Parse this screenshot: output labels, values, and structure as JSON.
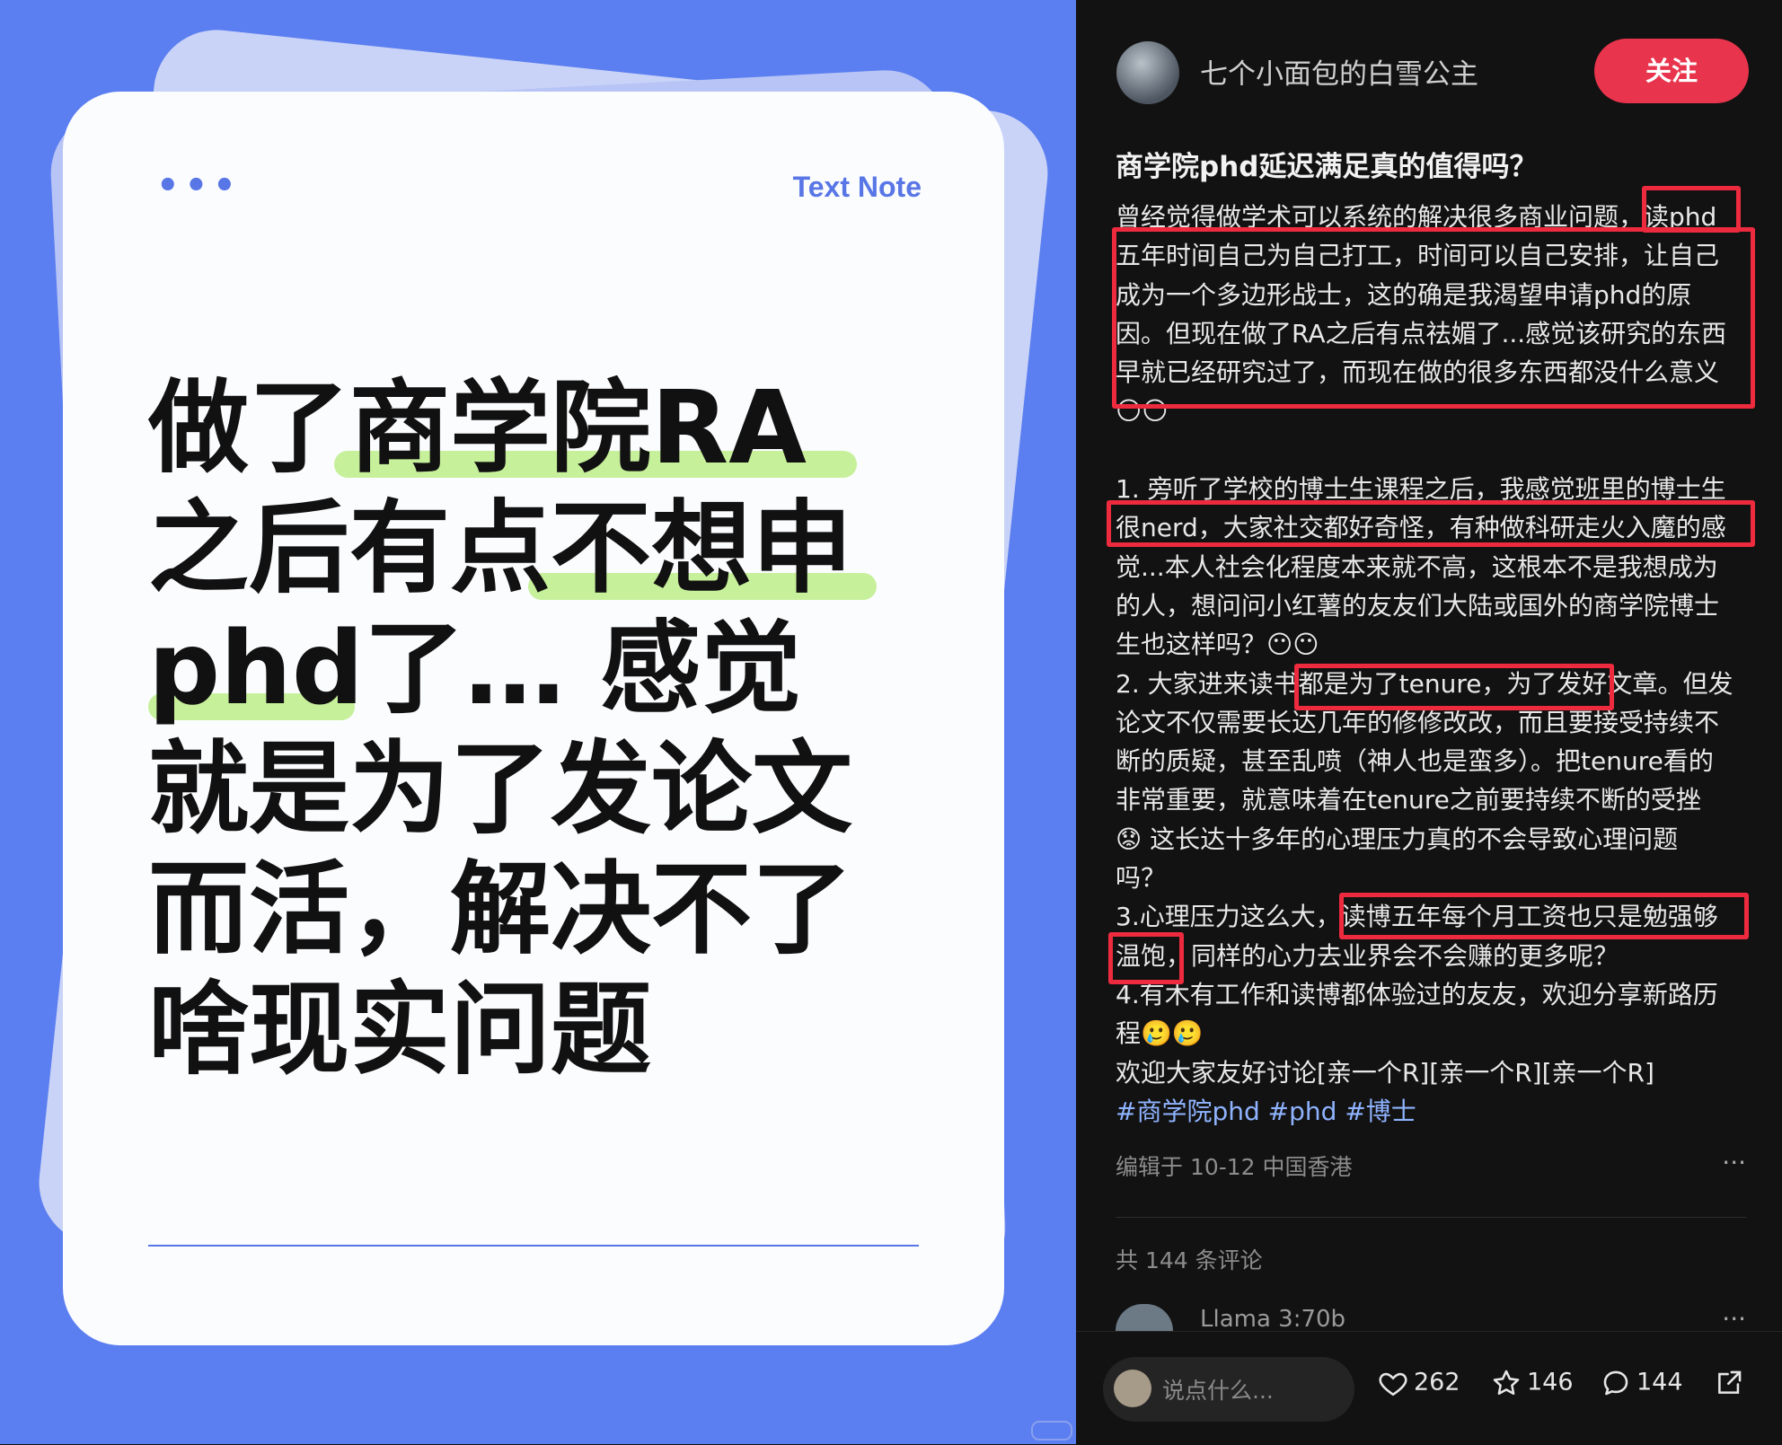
{
  "image_card": {
    "menu_dots": "•••",
    "label": "Text Note",
    "headline_lines": [
      "做了商学院RA",
      "之后有点不想申",
      "phd了… 感觉",
      "就是为了发论文",
      "而活，解决不了",
      "啥现实问题"
    ]
  },
  "header": {
    "author": "七个小面包的白雪公主",
    "follow_label": "关注"
  },
  "post": {
    "title": "商学院phd延迟满足真的值得吗？",
    "body_lines": [
      "曾经觉得做学术可以系统的解决很多商业问题，读phd",
      "五年时间自己为自己打工，时间可以自己安排，让自己",
      "成为一个多边形战士，这的确是我渴望申请phd的原",
      "因。但现在做了RA之后有点祛媚了...感觉该研究的东西",
      "早就已经研究过了，而现在做的很多东西都没什么意义",
      "😶😶",
      "",
      "1. 旁听了学校的博士生课程之后，我感觉班里的博士生",
      "很nerd，大家社交都好奇怪，有种做科研走火入魔的感",
      "觉...本人社会化程度本来就不高，这根本不是我想成为",
      "的人，想问问小红薯的友友们大陆或国外的商学院博士",
      "生也这样吗？😶😶",
      "2. 大家进来读书都是为了tenure，为了发好文章。但发",
      "论文不仅需要长达几年的修修改改，而且要接受持续不",
      "断的质疑，甚至乱喷（神人也是蛮多）。把tenure看的",
      "非常重要，就意味着在tenure之前要持续不断的受挫",
      "😟 这长达十多年的心理压力真的不会导致心理问题",
      "吗？",
      "3.心理压力这么大，读博五年每个月工资也只是勉强够",
      "温饱，同样的心力去业界会不会赚的更多呢？",
      "4.有木有工作和读博都体验过的友友，欢迎分享新路历",
      "程🥲🥲",
      "欢迎大家友好讨论[亲一个R][亲一个R][亲一个R]"
    ],
    "tags": [
      "#商学院phd",
      "#phd",
      "#博士"
    ],
    "edited": "编辑于 10-12 中国香港",
    "more": "···"
  },
  "comments": {
    "count_label": "共 144 条评论",
    "first_commenter": "Llama 3:70b",
    "more": "···"
  },
  "bottom_bar": {
    "input_placeholder": "说点什么...",
    "likes": "262",
    "stars": "146",
    "comments": "144"
  },
  "colors": {
    "left_bg": "#5b7ef0",
    "accent_blue": "#5876e6",
    "highlight_green": "#c7f09b",
    "follow_red": "#e8344c",
    "box_red": "#ee2b3e",
    "dark_bg": "#121212"
  }
}
